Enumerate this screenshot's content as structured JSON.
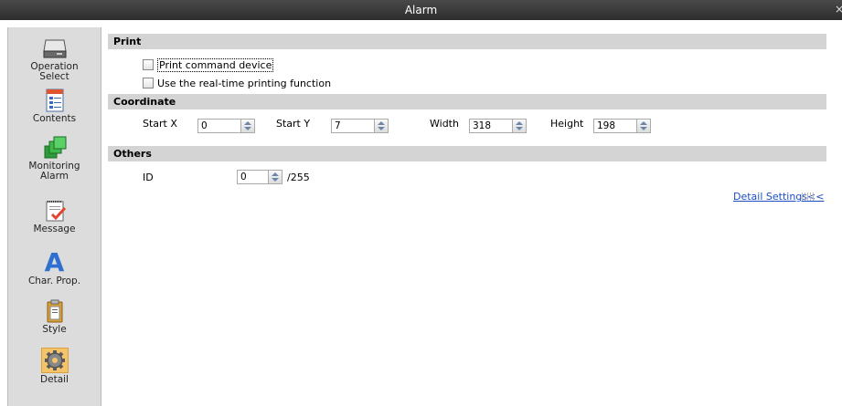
{
  "window": {
    "title": "Alarm",
    "close_glyph": "×"
  },
  "sidebar": {
    "items": [
      {
        "label": "Operation Select",
        "icon": "drive-icon"
      },
      {
        "label": "Contents",
        "icon": "contents-icon"
      },
      {
        "label": "Monitoring Alarm",
        "icon": "monitoring-alarm-icon"
      },
      {
        "label": "Message",
        "icon": "message-icon"
      },
      {
        "label": "Char. Prop.",
        "icon": "char-prop-icon",
        "glyph": "A"
      },
      {
        "label": "Style",
        "icon": "style-icon"
      },
      {
        "label": "Detail",
        "icon": "gear-icon",
        "active": true
      }
    ]
  },
  "print": {
    "heading": "Print",
    "print_command_device": {
      "label": "Print command device",
      "checked": false
    },
    "realtime_printing": {
      "label": "Use the real-time printing function",
      "checked": false
    }
  },
  "coordinate": {
    "heading": "Coordinate",
    "start_x": {
      "label": "Start X",
      "value": "0"
    },
    "start_y": {
      "label": "Start Y",
      "value": "7"
    },
    "width": {
      "label": "Width",
      "value": "318"
    },
    "height": {
      "label": "Height",
      "value": "198"
    }
  },
  "others": {
    "heading": "Others",
    "id": {
      "label": "ID",
      "value": "0",
      "max": "/255"
    }
  },
  "detail_settings_link": "Detail Settings<<",
  "colors": {
    "accent": "#f5c36a",
    "link": "#1a4fc4"
  }
}
